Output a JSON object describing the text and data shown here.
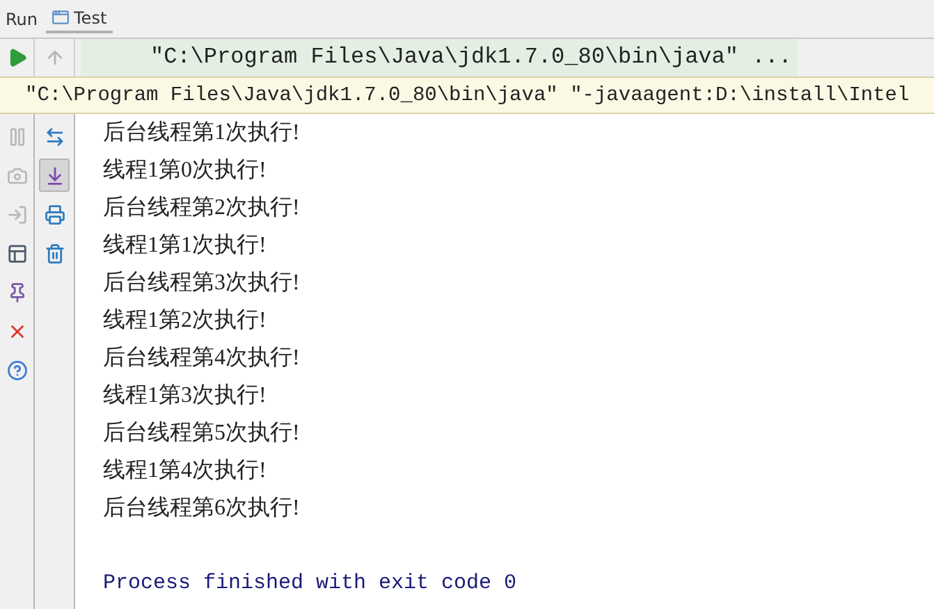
{
  "tool_window": {
    "title": "Run",
    "tab": {
      "label": "Test",
      "selected": true
    }
  },
  "toolbar": {
    "actions": [
      {
        "kind": "run",
        "disabled": false
      },
      {
        "kind": "up",
        "disabled": true
      }
    ],
    "run_config": "\"C:\\Program Files\\Java\\jdk1.7.0_80\\bin\\java\" ..."
  },
  "tooltip": "\"C:\\Program Files\\Java\\jdk1.7.0_80\\bin\\java\" \"-javaagent:D:\\install\\Intel",
  "left_actions": [
    {
      "kind": "pause",
      "disabled": true
    },
    {
      "kind": "camera",
      "disabled": true
    },
    {
      "kind": "exit",
      "disabled": true
    },
    {
      "kind": "layout",
      "disabled": false
    },
    {
      "kind": "pin",
      "disabled": false
    },
    {
      "kind": "close",
      "disabled": false
    },
    {
      "kind": "help",
      "disabled": false
    }
  ],
  "console_actions": [
    {
      "kind": "swap",
      "selected": false
    },
    {
      "kind": "scroll",
      "selected": true
    },
    {
      "kind": "print",
      "selected": false
    },
    {
      "kind": "trash",
      "selected": false
    }
  ],
  "console": [
    {
      "kind": "stdout",
      "text": "后台线程第1次执行!"
    },
    {
      "kind": "stdout",
      "text": "线程1第0次执行!"
    },
    {
      "kind": "stdout",
      "text": "后台线程第2次执行!"
    },
    {
      "kind": "stdout",
      "text": "线程1第1次执行!"
    },
    {
      "kind": "stdout",
      "text": "后台线程第3次执行!"
    },
    {
      "kind": "stdout",
      "text": "线程1第2次执行!"
    },
    {
      "kind": "stdout",
      "text": "后台线程第4次执行!"
    },
    {
      "kind": "stdout",
      "text": "线程1第3次执行!"
    },
    {
      "kind": "stdout",
      "text": "后台线程第5次执行!"
    },
    {
      "kind": "stdout",
      "text": "线程1第4次执行!"
    },
    {
      "kind": "stdout",
      "text": "后台线程第6次执行!"
    },
    {
      "kind": "system",
      "text": "Process finished with exit code 0"
    }
  ]
}
